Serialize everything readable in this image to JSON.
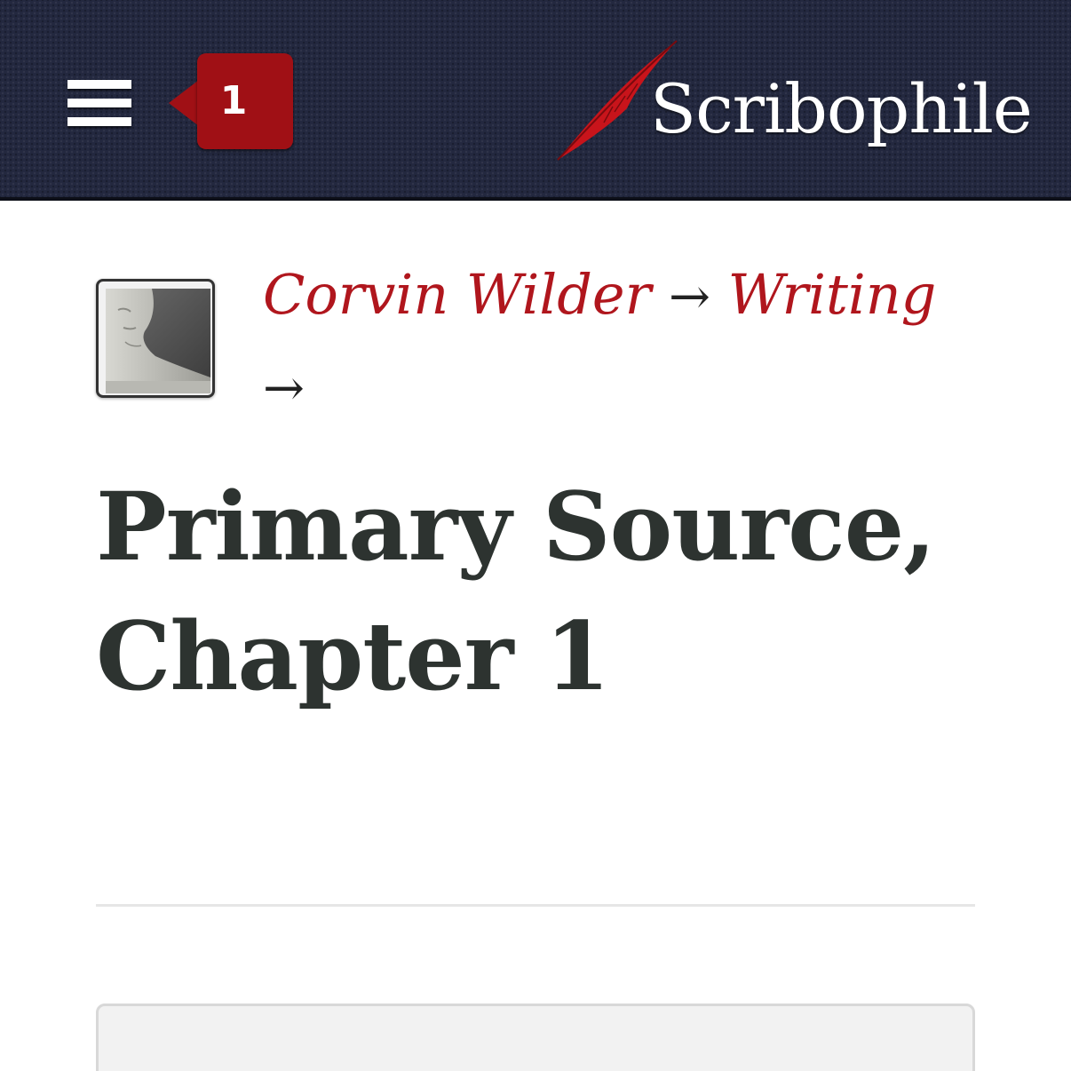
{
  "header": {
    "menu_icon": "hamburger-icon",
    "notification_count": "1",
    "logo_text": "Scribophile",
    "logo_icon": "quill-icon",
    "colors": {
      "background": "#23283f",
      "badge": "#a01015",
      "quill": "#c8141b"
    }
  },
  "breadcrumb": {
    "author": "Corvin Wilder",
    "separator": "→",
    "section": "Writing",
    "link_color": "#b0161d"
  },
  "page": {
    "title": "Primary Source, Chapter 1"
  }
}
